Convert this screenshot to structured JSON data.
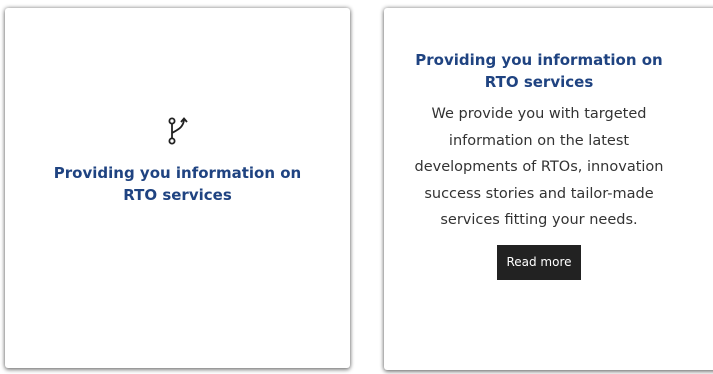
{
  "front_card": {
    "icon": "fork-branch-icon",
    "title_line1": "Providing you information on",
    "title_line2": "RTO services"
  },
  "back_card": {
    "title_line1": "Providing you information on",
    "title_line2": "RTO services",
    "description_lines": [
      "We provide you with targeted",
      "information on the latest",
      "developments of RTOs, innovation",
      "success stories and tailor-made",
      "services fitting your needs."
    ],
    "read_more_label": "Read more"
  },
  "colors": {
    "title": "#1f4381",
    "text": "#333333",
    "button_bg": "#222222",
    "button_text": "#ffffff"
  }
}
